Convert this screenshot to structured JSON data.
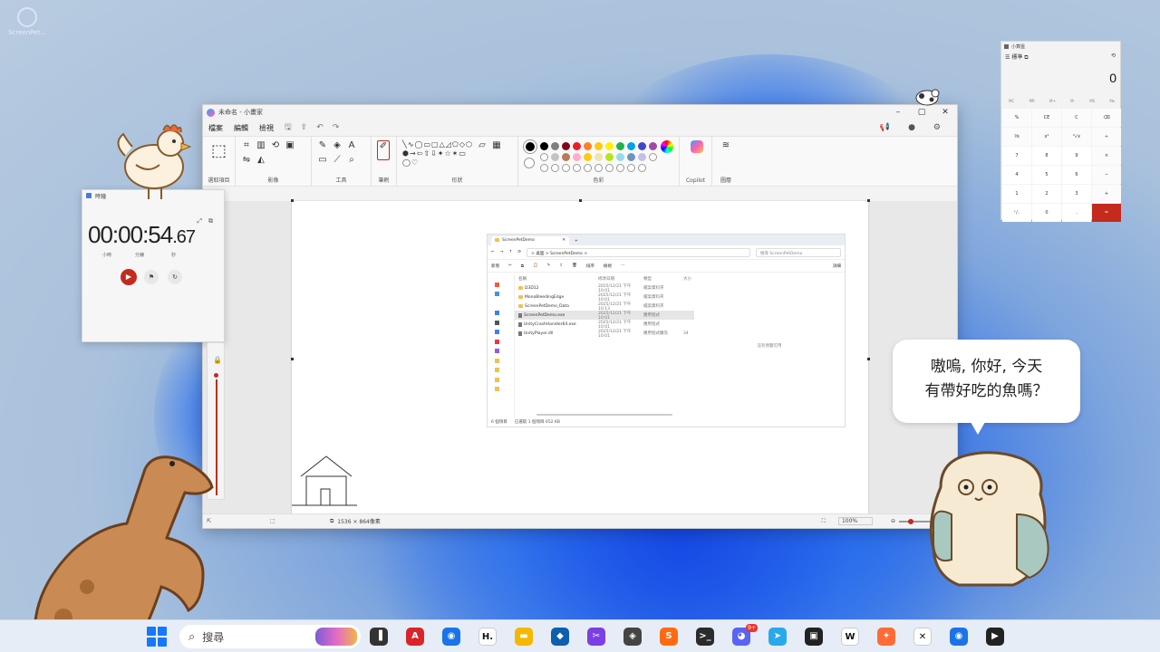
{
  "desktop": {
    "icon_label": "ScreenPet..."
  },
  "paint": {
    "title": "未命名 - 小畫家",
    "menu": [
      "檔案",
      "編輯",
      "檢視"
    ],
    "groups": [
      "選取項目",
      "影像",
      "工具",
      "筆刷",
      "形狀",
      "色彩",
      "Copilot",
      "圖層"
    ],
    "status_size": "1536 × 864像素",
    "zoom": "100%",
    "palette_row1": [
      "#000000",
      "#7f7f7f",
      "#880015",
      "#ed1c24",
      "#ff7f27",
      "#ffc90e",
      "#fff200",
      "#22b14c",
      "#00a2e8",
      "#3f48cc",
      "#a349a4"
    ],
    "palette_row2": [
      "#ffffff",
      "#c3c3c3",
      "#b97a57",
      "#ffaec9",
      "#ffc90e",
      "#efe4b0",
      "#b5e61d",
      "#99d9ea",
      "#7092be",
      "#c8bfe7",
      "#ffffff"
    ]
  },
  "explorer": {
    "tab": "ScreenPetDemo",
    "path": "> 桌面 > ScreenPetDemo >",
    "search_placeholder": "搜尋 ScreenPetDemo",
    "cmd_new": "新增",
    "cmd_sort": "排序",
    "cmd_view": "檢視",
    "cmd_details": "詳細",
    "headers": [
      "名稱",
      "修改日期",
      "類型",
      "大小"
    ],
    "rows": [
      {
        "name": "D3D12",
        "date": "2025/12/21 下午 10:01",
        "type": "檔案資料夾",
        "size": ""
      },
      {
        "name": "MonoBleedingEdge",
        "date": "2025/12/21 下午 10:01",
        "type": "檔案資料夾",
        "size": ""
      },
      {
        "name": "ScreenPetDemo_Data",
        "date": "2025/12/21 下午 10:13",
        "type": "檔案資料夾",
        "size": ""
      },
      {
        "name": "ScreenPetDemo.exe",
        "date": "2025/12/21 下午 10:01",
        "type": "應用程式",
        "size": ""
      },
      {
        "name": "UnityCrashHandler64.exe",
        "date": "2025/12/21 下午 10:01",
        "type": "應用程式",
        "size": ""
      },
      {
        "name": "UnityPlayer.dll",
        "date": "2025/12/21 下午 10:01",
        "type": "應用程式擴充",
        "size": "34"
      }
    ],
    "preview_note": "沒有預覽可用",
    "footer_count": "6 個項目",
    "footer_sel": "已選取 1 個項目  652 KB"
  },
  "clock": {
    "title": "時鐘",
    "time_main": "00:00:54",
    "time_ms": ".67",
    "units": [
      "小時",
      "分鐘",
      "秒"
    ],
    "play": "▶",
    "flag": "⚑",
    "reset": "↻"
  },
  "calc": {
    "title": "小算盤",
    "mode": "標準",
    "display": "0",
    "memory": [
      "MC",
      "MR",
      "M+",
      "M-",
      "MS",
      "M▾"
    ],
    "keys": [
      "%",
      "CE",
      "C",
      "⌫",
      "⅟x",
      "x²",
      "²√x",
      "÷",
      "7",
      "8",
      "9",
      "×",
      "4",
      "5",
      "6",
      "−",
      "1",
      "2",
      "3",
      "+",
      "⁺∕₋",
      "0",
      ".",
      "="
    ]
  },
  "bubble": {
    "line1": "嗷嗚, 你好, 今天",
    "line2": "有帶好吃的魚嗎？"
  },
  "taskbar": {
    "search": "搜尋",
    "apps": [
      {
        "name": "task-view",
        "glyph": "▐",
        "color": "#333333"
      },
      {
        "name": "anki",
        "glyph": "A",
        "color": "#d9252a"
      },
      {
        "name": "chrome",
        "glyph": "◉",
        "color": "#1a73e8"
      },
      {
        "name": "hypr",
        "glyph": "H.",
        "color": "#ffffff"
      },
      {
        "name": "file-explorer",
        "glyph": "▬",
        "color": "#f5b800"
      },
      {
        "name": "sourcetree",
        "glyph": "◆",
        "color": "#0d5fb0"
      },
      {
        "name": "snip",
        "glyph": "✂",
        "color": "#7b3fe4"
      },
      {
        "name": "unity",
        "glyph": "◈",
        "color": "#444444"
      },
      {
        "name": "sublime",
        "glyph": "S",
        "color": "#ff6a13"
      },
      {
        "name": "terminal",
        "glyph": ">_",
        "color": "#2b2b2b"
      },
      {
        "name": "discord",
        "glyph": "◕",
        "color": "#5865f2"
      },
      {
        "name": "telegram",
        "glyph": "➤",
        "color": "#29a9eb"
      },
      {
        "name": "notion",
        "glyph": "▣",
        "color": "#222222"
      },
      {
        "name": "webtoon",
        "glyph": "W",
        "color": "#ffffff"
      },
      {
        "name": "postman",
        "glyph": "✦",
        "color": "#ff6c37"
      },
      {
        "name": "capcut",
        "glyph": "✕",
        "color": "#ffffff"
      },
      {
        "name": "chrome-2",
        "glyph": "◉",
        "color": "#1a73e8"
      },
      {
        "name": "media-player",
        "glyph": "▶",
        "color": "#222222"
      }
    ],
    "discord_badge": "9+"
  }
}
